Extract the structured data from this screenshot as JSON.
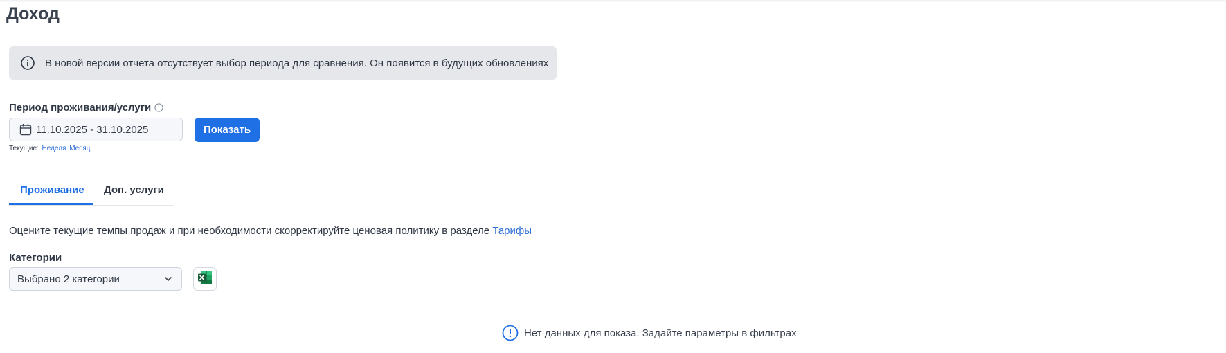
{
  "page": {
    "title": "Доход"
  },
  "banner": {
    "icon": "info-icon",
    "text": "В новой версии отчета отсутствует выбор периода для сравнения. Он появится в будущих обновлениях"
  },
  "period": {
    "label": "Период проживания/услуги",
    "help_icon": "info-circle-icon",
    "date_icon": "calendar-icon",
    "value": "11.10.2025 - 31.10.2025",
    "show_button": "Показать",
    "quick_label": "Текущие:",
    "quick_links": [
      "Неделя",
      "Месяц"
    ]
  },
  "tabs": [
    {
      "label": "Проживание",
      "active": true
    },
    {
      "label": "Доп. услуги",
      "active": false
    }
  ],
  "description": {
    "text": "Оцените текущие темпы продаж и при необходимости скорректируйте ценовая политику в разделе ",
    "link": "Тарифы"
  },
  "categories": {
    "label": "Категории",
    "selected": "Выбрано 2 категории",
    "dropdown_icon": "chevron-down-icon",
    "export_icon": "excel-icon"
  },
  "empty_state": {
    "icon": "exclamation-circle-icon",
    "text": "Нет данных для показа. Задайте параметры в фильтрах"
  },
  "colors": {
    "accent": "#1f6fe5",
    "link": "#2f6fd8",
    "banner_bg": "#e5e7eb",
    "excel_green": "#1e7145"
  }
}
